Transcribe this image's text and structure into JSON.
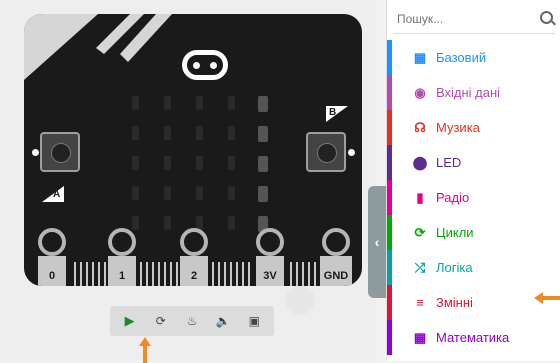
{
  "simulator": {
    "buttons": {
      "a": "A",
      "b": "B"
    },
    "pins": [
      "0",
      "1",
      "2",
      "3V",
      "GND"
    ],
    "led_matrix": [
      [
        0,
        0,
        0,
        0,
        1
      ],
      [
        0,
        0,
        0,
        0,
        1
      ],
      [
        0,
        0,
        0,
        0,
        1
      ],
      [
        0,
        0,
        0,
        0,
        1
      ],
      [
        0,
        0,
        0,
        0,
        1
      ]
    ]
  },
  "toolbar": {
    "icons": [
      "play-icon",
      "restart-icon",
      "debug-icon",
      "sound-icon",
      "fullscreen-icon"
    ]
  },
  "toolbox": {
    "search_placeholder": "Пошук...",
    "categories": [
      {
        "label": "Базовий",
        "color": "#1e90ff",
        "icon": "grid-icon"
      },
      {
        "label": "Вхідні дані",
        "color": "#b34ab3",
        "icon": "target-icon"
      },
      {
        "label": "Музика",
        "color": "#e63022",
        "icon": "headphones-icon"
      },
      {
        "label": "LED",
        "color": "#5c2d91",
        "icon": "toggle-icon"
      },
      {
        "label": "Радіо",
        "color": "#e3008c",
        "icon": "signal-bars-icon"
      },
      {
        "label": "Цикли",
        "color": "#00aa00",
        "icon": "loop-icon"
      },
      {
        "label": "Логіка",
        "color": "#00a4a6",
        "icon": "shuffle-icon"
      },
      {
        "label": "Змінні",
        "color": "#dc143c",
        "icon": "list-icon"
      },
      {
        "label": "Математика",
        "color": "#9400d3",
        "icon": "calculator-icon"
      }
    ]
  },
  "colors": {
    "accent_arrow": "#f08a24"
  }
}
